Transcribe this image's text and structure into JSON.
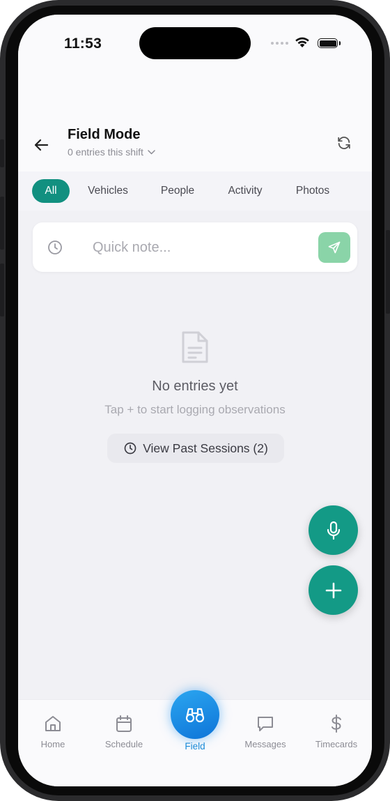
{
  "status_bar": {
    "time": "11:53"
  },
  "header": {
    "title": "Field Mode",
    "subtitle": "0 entries this shift"
  },
  "filters": [
    {
      "label": "All",
      "active": true
    },
    {
      "label": "Vehicles",
      "active": false
    },
    {
      "label": "People",
      "active": false
    },
    {
      "label": "Activity",
      "active": false
    },
    {
      "label": "Photos",
      "active": false
    }
  ],
  "quick_note": {
    "placeholder": "Quick note...",
    "value": ""
  },
  "empty_state": {
    "title": "No entries yet",
    "subtitle": "Tap + to start logging observations",
    "past_sessions_label": "View Past Sessions (2)"
  },
  "tabs": [
    {
      "label": "Home",
      "icon": "home-icon"
    },
    {
      "label": "Schedule",
      "icon": "calendar-icon"
    },
    {
      "label": "Field",
      "icon": "binoculars-icon",
      "active": true
    },
    {
      "label": "Messages",
      "icon": "chat-icon"
    },
    {
      "label": "Timecards",
      "icon": "dollar-icon"
    }
  ],
  "colors": {
    "accent": "#129080",
    "fab": "#139a86",
    "send_button": "#8ad4a8",
    "field_tab": "#1a8ad8"
  }
}
